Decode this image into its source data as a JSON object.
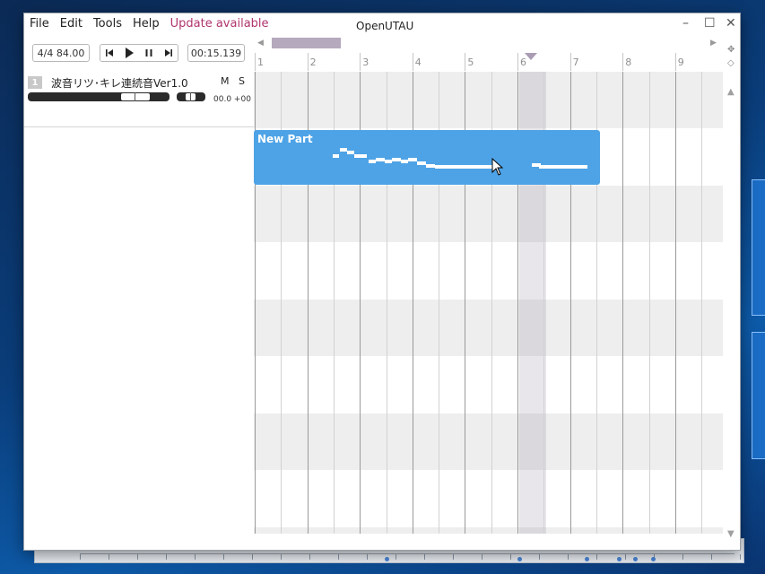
{
  "app": {
    "title": "OpenUTAU"
  },
  "menu": {
    "items": [
      "File",
      "Edit",
      "Tools",
      "Help"
    ],
    "update_label": "Update available"
  },
  "toolbar": {
    "time_signature_bpm": "4/4  84.00",
    "playback_time": "00:15.139",
    "transport": [
      "skip-back-icon",
      "play-icon",
      "pause-icon",
      "skip-forward-icon"
    ]
  },
  "track": {
    "number": "1",
    "singer": "波音リツ･キレ連続音Ver1.0",
    "mute_label": "M",
    "solo_label": "S",
    "volume_text": "00.0",
    "pan_text": "+00",
    "volume_level": 0.75,
    "pan_level": 0.5
  },
  "timeline": {
    "bars": [
      "1",
      "2",
      "3",
      "4",
      "5",
      "6",
      "7",
      "8",
      "9"
    ],
    "playhead_bar": 6.25
  },
  "part": {
    "name": "New Part"
  },
  "colors": {
    "part": "#4ea3e6",
    "update_text": "#b0356e",
    "scroll_thumb": "#b5a9bd"
  }
}
